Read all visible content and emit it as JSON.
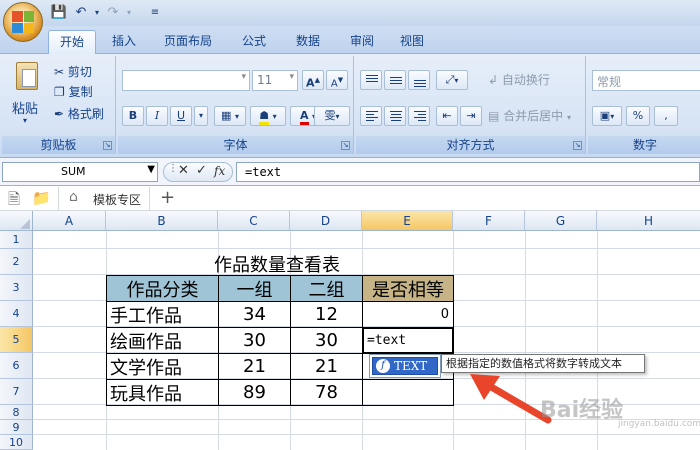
{
  "tabs": [
    "开始",
    "插入",
    "页面布局",
    "公式",
    "数据",
    "审阅",
    "视图"
  ],
  "active_tab": "开始",
  "ribbon": {
    "clipboard": {
      "paste": "粘贴",
      "cut": "剪切",
      "copy": "复制",
      "format_painter": "格式刷",
      "label": "剪贴板"
    },
    "font": {
      "font_name": "",
      "font_size": "11",
      "bold": "B",
      "italic": "I",
      "underline": "U",
      "label": "字体",
      "grow": "A",
      "shrink": "A",
      "phonetic": "雯"
    },
    "alignment": {
      "wrap_text": "自动换行",
      "merge_center": "合并后居中",
      "label": "对齐方式"
    },
    "number": {
      "format": "常规",
      "percent": "%",
      "comma": ",",
      "label": "数字"
    }
  },
  "formula_bar": {
    "name_box": "SUM",
    "formula": "=text"
  },
  "doc_tabs": {
    "template_tab": "模板专区",
    "add": "+"
  },
  "columns": [
    "A",
    "B",
    "C",
    "D",
    "E",
    "F",
    "G",
    "H"
  ],
  "rows": [
    "1",
    "2",
    "3",
    "4",
    "5",
    "6",
    "7",
    "8",
    "9",
    "10"
  ],
  "sheet": {
    "title": "作品数量查看表",
    "headers": [
      "作品分类",
      "一组",
      "二组",
      "是否相等"
    ],
    "data": [
      [
        "手工作品",
        "34",
        "12",
        "0"
      ],
      [
        "绘画作品",
        "30",
        "30",
        "=text"
      ],
      [
        "文学作品",
        "21",
        "21",
        ""
      ],
      [
        "玩具作品",
        "89",
        "78",
        ""
      ]
    ]
  },
  "autocomplete": {
    "item": "TEXT",
    "tooltip": "根据指定的数值格式将数字转成文本"
  },
  "watermark": {
    "main": "Bai经验",
    "sub": "jingyan.baidu.com"
  },
  "colors": {
    "header_blue": "#9fc4d6",
    "header_gold": "#c6b386",
    "selection": "#3168c7",
    "arrow": "#e8452a"
  }
}
